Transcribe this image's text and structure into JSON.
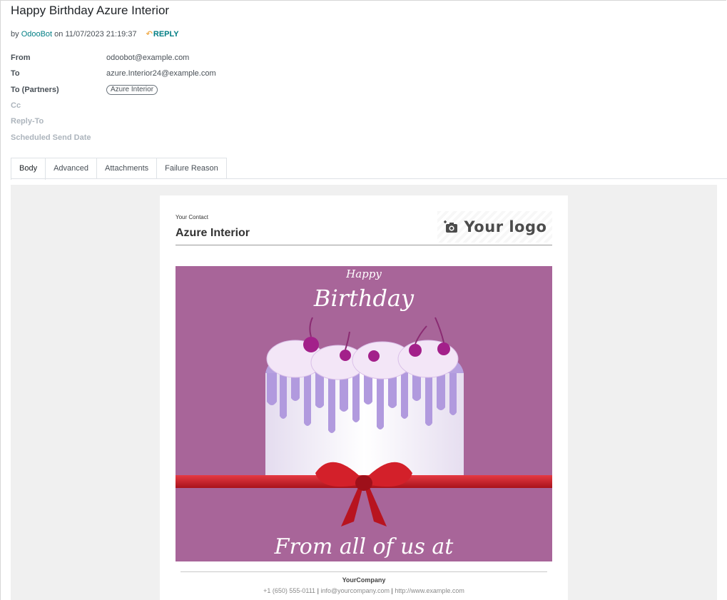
{
  "message": {
    "subject": "Happy Birthday Azure Interior",
    "by_prefix": "by",
    "author": "OdooBot",
    "on_prefix": "on",
    "datetime": "11/07/2023 21:19:37",
    "reply_label": "REPLY"
  },
  "fields": {
    "from_label": "From",
    "from_value": "odoobot@example.com",
    "to_label": "To",
    "to_value": "azure.Interior24@example.com",
    "to_partners_label": "To (Partners)",
    "to_partners_tag": "Azure Interior",
    "cc_label": "Cc",
    "reply_to_label": "Reply-To",
    "scheduled_label": "Scheduled Send Date"
  },
  "tabs": [
    {
      "label": "Body",
      "active": true
    },
    {
      "label": "Advanced"
    },
    {
      "label": "Attachments"
    },
    {
      "label": "Failure Reason"
    }
  ],
  "email": {
    "contact_label": "Your Contact",
    "contact_name": "Azure Interior",
    "logo_text": "Your logo",
    "logo_icon": "camera-plus-icon",
    "banner_happy": "Happy",
    "banner_birthday": "Birthday",
    "banner_from": "From all of us at",
    "company_name": "YourCompany",
    "phone": "+1 (650) 555-0111",
    "email": "info@yourcompany.com",
    "website": "http://www.example.com",
    "separator": "|"
  },
  "colors": {
    "link": "#017e84",
    "reply_icon": "#f0ad4e",
    "banner_bg": "#a86599",
    "ribbon": "#d3202a"
  },
  "icons": {
    "reply": "reply-arrow-icon"
  }
}
